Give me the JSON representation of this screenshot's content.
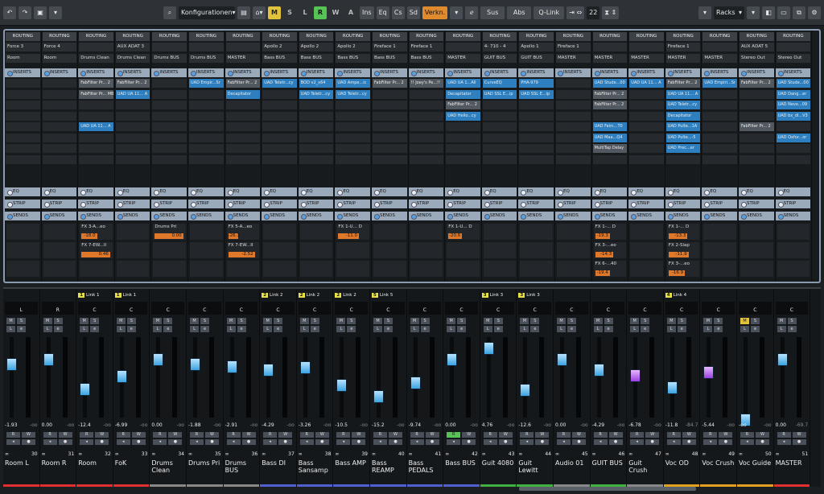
{
  "toolbar": {
    "config": "Konfigurationen",
    "m": "M",
    "s": "S",
    "l": "L",
    "r": "R",
    "w": "W",
    "a": "A",
    "ins": "Ins",
    "eq": "Eq",
    "cs": "Cs",
    "sd": "Sd",
    "verkn": "Verkn.",
    "sus": "Sus",
    "abs": "Abs",
    "qlink": "Q-Link",
    "zoom": "22",
    "racks": "Racks"
  },
  "sections": {
    "routing": "ROUTING",
    "inserts": "INSERTS",
    "eq": "EQ",
    "strip": "STRIP",
    "sends": "SENDS"
  },
  "channels": [
    {
      "name": "Room L",
      "num": "30",
      "in": "Force 3",
      "out": "Room",
      "pan": "L",
      "color": "#e03030",
      "vol": "-1.93",
      "vol2": "-oo"
    },
    {
      "name": "Room R",
      "num": "31",
      "in": "Force 4",
      "out": "Room",
      "pan": "R",
      "color": "#e03030",
      "vol": "0.00",
      "vol2": "-oo"
    },
    {
      "name": "Room",
      "num": "32",
      "in": "",
      "out": "Drums Clean",
      "pan": "C",
      "link": "1",
      "linkName": "Link 1",
      "color": "#e03030",
      "vol": "-12.4",
      "vol2": "-oo"
    },
    {
      "name": "FoK",
      "num": "33",
      "in": "AUX ADAT 3",
      "out": "Drums Clean",
      "pan": "C",
      "link": "1",
      "linkName": "Link 1",
      "color": "#e03030",
      "vol": "-6.99",
      "vol2": "-oo"
    },
    {
      "name": "Drums Clean",
      "num": "34",
      "in": "",
      "out": "Drums BUS",
      "pan": "C",
      "color": "#888",
      "vol": "0.00",
      "vol2": "-oo"
    },
    {
      "name": "Drums Pri",
      "num": "35",
      "in": "",
      "out": "Drums BUS",
      "pan": "C",
      "color": "#888",
      "vol": "-1.88",
      "vol2": "-oo"
    },
    {
      "name": "Drums BUS",
      "num": "36",
      "in": "",
      "out": "MASTER",
      "pan": "C",
      "color": "#888",
      "vol": "-2.91",
      "vol2": "-oo"
    },
    {
      "name": "Bass DI",
      "num": "37",
      "in": "Apollo 2",
      "out": "Bass BUS",
      "pan": "C",
      "link": "2",
      "linkName": "Link 2",
      "color": "#5060d0",
      "vol": "-4.29",
      "vol2": "-oo"
    },
    {
      "name": "Bass Sansamp",
      "num": "38",
      "in": "Apollo 2",
      "out": "Bass BUS",
      "pan": "C",
      "link": "2",
      "linkName": "Link 2",
      "color": "#5060d0",
      "vol": "-3.26",
      "vol2": "-oo"
    },
    {
      "name": "Bass AMP",
      "num": "39",
      "in": "Apollo 2",
      "out": "Bass BUS",
      "pan": "C",
      "link": "2",
      "linkName": "Link 2",
      "color": "#5060d0",
      "vol": "-10.5",
      "vol2": "-oo"
    },
    {
      "name": "Bass REAMP",
      "num": "40",
      "in": "Fireface 1",
      "out": "Bass BUS",
      "pan": "C",
      "link": "5",
      "linkName": "Link 5",
      "color": "#5060d0",
      "vol": "-15.2",
      "vol2": "-oo"
    },
    {
      "name": "Bass PEDALS",
      "num": "41",
      "in": "Fireface 1",
      "out": "Bass BUS",
      "pan": "C",
      "color": "#5060d0",
      "vol": "-9.74",
      "vol2": "-oo"
    },
    {
      "name": "Bass BUS",
      "num": "42",
      "in": "",
      "out": "MASTER",
      "pan": "C",
      "color": "#5060d0",
      "vol": "0.00",
      "vol2": "-oo"
    },
    {
      "name": "Guit 4080",
      "num": "43",
      "in": "4- 710 - 4",
      "out": "GUIT BUS",
      "pan": "C",
      "link": "3",
      "linkName": "Link 3",
      "color": "#40b040",
      "vol": "4.76",
      "vol2": "-oo"
    },
    {
      "name": "Guit Lewitt",
      "num": "44",
      "in": "Apollo 1",
      "out": "GUIT BUS",
      "pan": "C",
      "link": "3",
      "linkName": "Link 3",
      "color": "#40b040",
      "vol": "-12.6",
      "vol2": "-oo"
    },
    {
      "name": "Audio 01",
      "num": "45",
      "in": "Fireface 1",
      "out": "MASTER",
      "pan": "C",
      "color": "#888",
      "vol": "0.00",
      "vol2": "-oo"
    },
    {
      "name": "GUIT BUS",
      "num": "46",
      "in": "",
      "out": "MASTER",
      "pan": "C",
      "color": "#40b040",
      "vol": "-4.29",
      "vol2": "-oo"
    },
    {
      "name": "Guit Crush",
      "num": "47",
      "in": "",
      "out": "MASTER",
      "pan": "C",
      "color": "#888",
      "vol": "-6.78",
      "vol2": "-oo"
    },
    {
      "name": "Voc OD",
      "num": "48",
      "in": "Fireface 1",
      "out": "MASTER",
      "pan": "C",
      "link": "4",
      "linkName": "Link 4",
      "color": "#e0a020",
      "vol": "-11.8",
      "vol2": "-84.7"
    },
    {
      "name": "Voc Crush",
      "num": "49",
      "in": "",
      "out": "MASTER",
      "pan": "C",
      "color": "#e0a020",
      "vol": "-5.44",
      "vol2": "-oo"
    },
    {
      "name": "Voc Guide",
      "num": "50",
      "in": "AUX ADAT 5",
      "out": "Stereo Out",
      "pan": "C",
      "color": "#e0a020",
      "vol": "-oo",
      "vol2": "-oo"
    },
    {
      "name": "MASTER",
      "num": "51",
      "in": "",
      "out": "Stereo Out",
      "pan": "C",
      "color": "#e03030",
      "vol": "0.00",
      "vol2": "-69.7"
    }
  ],
  "inserts": [
    [],
    [],
    [
      "FabFilter Pr... 2",
      "FabFilter Pr... MB",
      "",
      "",
      "UAD UA 11... A"
    ],
    [
      "FabFilter Pr... 2",
      "UAD UA 11... A"
    ],
    [],
    [
      "UAD Empir...Sr"
    ],
    [
      "FabFilter Pr... 2",
      "Decapitator"
    ],
    [
      "UAD Teletr...cy"
    ],
    [
      "BOD v2_x64",
      "UAD Teletr...cy"
    ],
    [
      "UAD Ampe...ic",
      "UAD Teletr...cy"
    ],
    [
      "FabFilter Pr... 2"
    ],
    [
      "!! Joey's Pe...!!"
    ],
    [
      "UAD UA 1...All",
      "Decapitator",
      "FabFilter Pr... 2",
      "UAD Helio...cy"
    ],
    [
      "CurveEQ",
      "UAD SSL E...ip"
    ],
    [
      "PHA-979",
      "UAD SSL E...ip"
    ],
    [],
    [
      "UAD Stude...00",
      "FabFilter Pr... 2",
      "FabFilter Pr... 2",
      "",
      "UAD Fairc...T0",
      "UAD Maa...Q4",
      "MultiTap Delay"
    ],
    [
      "UAD UA 11... A"
    ],
    [
      "FabFilter Pr... 2",
      "UAD UA 11... A",
      "UAD Teletr...cy",
      "Decapitator",
      "UAD Pulte...1A",
      "UAD Pulte...-5",
      "UAD Prec...er"
    ],
    [
      "UAD Empiri...Sr"
    ],
    [
      "FabFilter Pr... 2",
      "",
      "",
      "",
      "FabFilter Pr... 2"
    ],
    [
      "UAD Stude...00",
      "UAD Dang...er",
      "UAD Neve...09",
      "UAD bx_di...V3",
      "",
      "UAD Oxfor...or"
    ]
  ],
  "sends": [
    [],
    [],
    [
      {
        "n": "FX 3-A...eo",
        "v": "-18.0"
      },
      {
        "n": "FX 7-EW...II",
        "v": "0.46"
      }
    ],
    [],
    [
      {
        "n": "Drums Pri",
        "v": "0.00"
      }
    ],
    [],
    [
      {
        "n": "FX 5-A...eo",
        "v": "-26.1"
      },
      {
        "n": "FX 7-EW...II",
        "v": "-2.52"
      }
    ],
    [],
    [],
    [
      {
        "n": "FX 1-U... D",
        "v": "-11.0"
      }
    ],
    [],
    [],
    [
      {
        "n": "FX 1-U... D",
        "v": "-20.6"
      }
    ],
    [],
    [],
    [],
    [
      {
        "n": "FX 1-... D",
        "v": "-19.3"
      },
      {
        "n": "FX 3-...eo",
        "v": "-14.3"
      },
      {
        "n": "FX 6-...40",
        "v": "-19.4"
      }
    ],
    [],
    [
      {
        "n": "FX 1-... D",
        "v": "-13.3"
      },
      {
        "n": "FX 2-Slap",
        "v": "-11.9"
      },
      {
        "n": "FX 3-...eo",
        "v": "-16.9"
      }
    ],
    [],
    [],
    []
  ]
}
